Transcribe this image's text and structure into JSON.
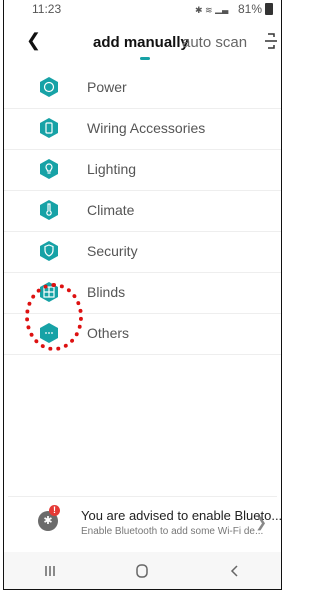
{
  "status_bar": {
    "time": "11:23",
    "battery_pct": "81%"
  },
  "header": {
    "back_icon": "chevron-left-icon",
    "tabs": [
      {
        "label": "add manually"
      },
      {
        "label": "auto scan"
      }
    ],
    "scan_icon": "scan-icon"
  },
  "categories": [
    {
      "label": "Power",
      "icon": "power-icon"
    },
    {
      "label": "Wiring Accessories",
      "icon": "switch-icon"
    },
    {
      "label": "Lighting",
      "icon": "bulb-icon"
    },
    {
      "label": "Climate",
      "icon": "thermometer-icon"
    },
    {
      "label": "Security",
      "icon": "shield-icon"
    },
    {
      "label": "Blinds",
      "icon": "window-icon"
    },
    {
      "label": "Others",
      "icon": "more-icon"
    }
  ],
  "banner": {
    "title": "You are advised to enable Blueto...",
    "subtitle": "Enable Bluetooth to add some Wi-Fi de...",
    "badge": "!"
  },
  "colors": {
    "accent": "#17a2a6",
    "alert": "#e53935",
    "annotation": "#dd1111"
  },
  "navbar": {
    "recents_icon": "recents-icon",
    "home_icon": "home-icon",
    "back_icon": "back-icon"
  }
}
